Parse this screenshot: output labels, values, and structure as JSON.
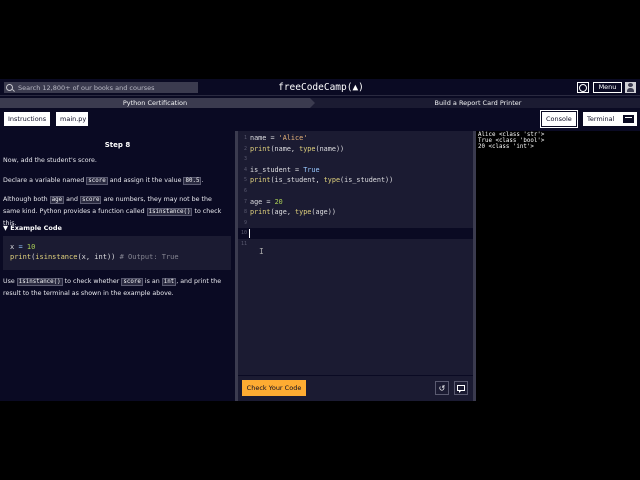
{
  "nav": {
    "search_placeholder": "Search 12,800+ of our books and courses",
    "logo_text": "freeCodeCamp(▲)",
    "menu_label": "Menu"
  },
  "breadcrumb": {
    "course": "Python Certification",
    "project": "Build a Report Card Printer"
  },
  "tabs": {
    "instructions": "Instructions",
    "file": "main.py",
    "console": "Console",
    "terminal": "Terminal"
  },
  "instructions": {
    "step_title": "Step 8",
    "p1": "Now, add the student's score.",
    "p2_a": "Declare a variable named ",
    "p2_code": "score",
    "p2_b": " and assign it the value ",
    "p2_val": "80.5",
    "p2_c": ".",
    "p3_a": "Although both ",
    "p3_code1": "age",
    "p3_b": " and ",
    "p3_code2": "score",
    "p3_c": " are numbers, they may not be the same kind. Python provides a function called ",
    "p3_code3": "isinstance()",
    "p3_d": " to check this.",
    "example_title": "▼ Example Code",
    "example_line1_a": "x ",
    "example_line1_b": "=",
    "example_line1_c": " 10",
    "example_line2_fn1": "print",
    "example_line2_p1": "(",
    "example_line2_fn2": "isinstance",
    "example_line2_args": "(x, int))",
    "example_line2_comment": " # Output: True",
    "p4_a": "Use ",
    "p4_code1": "isinstance()",
    "p4_b": " to check whether ",
    "p4_code2": "score",
    "p4_c": " is an ",
    "p4_code3": "int",
    "p4_d": ", and print the result to the terminal as shown in the example above."
  },
  "editor": {
    "lines": [
      {
        "no": "1",
        "text": "name = 'Alice'"
      },
      {
        "no": "2",
        "text": "print(name, type(name))"
      },
      {
        "no": "3",
        "text": ""
      },
      {
        "no": "4",
        "text": "is_student = True"
      },
      {
        "no": "5",
        "text": "print(is_student, type(is_student))"
      },
      {
        "no": "6",
        "text": ""
      },
      {
        "no": "7",
        "text": "age = 20"
      },
      {
        "no": "8",
        "text": "print(age, type(age))"
      },
      {
        "no": "9",
        "text": ""
      },
      {
        "no": "10",
        "text": ""
      },
      {
        "no": "11",
        "text": ""
      }
    ],
    "check_button": "Check Your Code"
  },
  "terminal": {
    "lines": [
      "Alice <class 'str'>",
      "True <class 'bool'>",
      "20 <class 'int'>"
    ]
  },
  "colors": {
    "background": "#0a0a23",
    "panel": "#1b1b32",
    "accent": "#feac32",
    "code_string": "#e9b57a",
    "code_builtin": "#e2d37e",
    "code_keyword": "#99c9ff",
    "code_number": "#acd157"
  }
}
